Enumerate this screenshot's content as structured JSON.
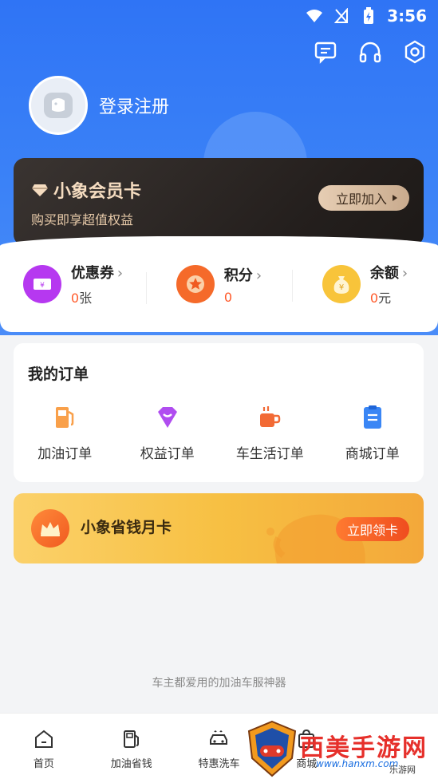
{
  "status_bar": {
    "time": "3:56"
  },
  "header": {
    "login_label": "登录注册",
    "icons": [
      "message-icon",
      "headset-icon",
      "settings-icon"
    ]
  },
  "member_card": {
    "title": "小象会员卡",
    "subtitle": "购买即享超值权益",
    "join_label": "立即加入"
  },
  "stats": [
    {
      "label": "优惠券",
      "value": "0",
      "unit": "张",
      "icon": "coupon-icon",
      "color": "#b638f0"
    },
    {
      "label": "积分",
      "value": "0",
      "unit": "",
      "icon": "star-icon",
      "color": "#f56a2a"
    },
    {
      "label": "余额",
      "value": "0",
      "unit": "元",
      "icon": "money-bag-icon",
      "color": "#f8c43a"
    }
  ],
  "orders": {
    "title": "我的订单",
    "items": [
      {
        "label": "加油订单",
        "icon": "fuel-icon"
      },
      {
        "label": "权益订单",
        "icon": "equity-icon"
      },
      {
        "label": "车生活订单",
        "icon": "coffee-icon"
      },
      {
        "label": "商城订单",
        "icon": "clipboard-icon"
      }
    ]
  },
  "month_card": {
    "title": "小象省钱月卡",
    "button_label": "立即领卡"
  },
  "slogan": "车主都爱用的加油车服神器",
  "tabbar": [
    {
      "label": "首页",
      "icon": "home-icon"
    },
    {
      "label": "加油省钱",
      "icon": "fuel-pump-icon"
    },
    {
      "label": "特惠洗车",
      "icon": "car-wash-icon"
    },
    {
      "label": "商城",
      "icon": "shop-icon"
    }
  ],
  "watermark": {
    "title": "西美手游网",
    "url": "www.hanxm.com",
    "sub": "乐游网"
  }
}
